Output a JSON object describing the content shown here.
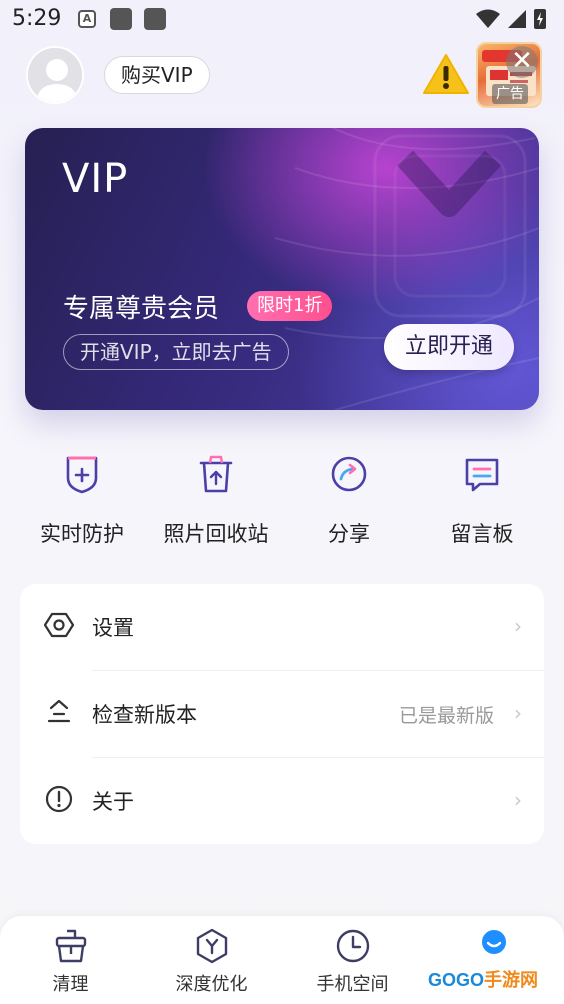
{
  "status_bar": {
    "time": "5:29",
    "notif_a": "A"
  },
  "header": {
    "buy_vip_label": "购买VIP",
    "ad_label": "广告",
    "ad_close": "✕"
  },
  "vip_card": {
    "title": "VIP",
    "headline": "专属尊贵会员",
    "promo_badge": "限时1折",
    "subtitle": "开通VIP，立即去广告",
    "open_button": "立即开通"
  },
  "features": [
    {
      "label": "实时防护",
      "icon": "shield-plus-icon"
    },
    {
      "label": "照片回收站",
      "icon": "trash-icon"
    },
    {
      "label": "分享",
      "icon": "share-icon"
    },
    {
      "label": "留言板",
      "icon": "message-board-icon"
    }
  ],
  "settings": [
    {
      "label": "设置",
      "value": "",
      "icon": "settings-hex-icon"
    },
    {
      "label": "检查新版本",
      "value": "已是最新版",
      "icon": "update-icon"
    },
    {
      "label": "关于",
      "value": "",
      "icon": "info-icon"
    }
  ],
  "chevron": "›",
  "bottom_nav": [
    {
      "label": "清理",
      "icon": "cleanup-icon"
    },
    {
      "label": "深度优化",
      "icon": "deep-optimize-icon"
    },
    {
      "label": "手机空间",
      "icon": "storage-clock-icon"
    },
    {
      "label": "",
      "icon": "profile-dot-icon"
    }
  ],
  "watermark": {
    "part1": "GOGO",
    "part2": "手游网"
  },
  "colors": {
    "accent": "#7b5cf0",
    "promo": "#ff4f8e",
    "card_dark": "#262052"
  }
}
